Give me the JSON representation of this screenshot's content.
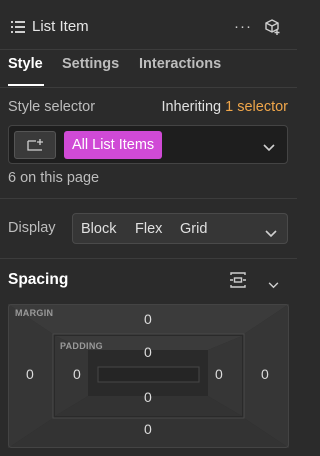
{
  "header": {
    "title": "List Item",
    "icons": [
      "list-icon",
      "more-icon",
      "cube-icon"
    ],
    "more_glyph": "···"
  },
  "tabs": [
    {
      "label": "Style",
      "active": true
    },
    {
      "label": "Settings",
      "active": false
    },
    {
      "label": "Interactions",
      "active": false
    }
  ],
  "style_selector": {
    "label": "Style selector",
    "inheriting_prefix": "Inheriting",
    "inheriting_count": "1 selector",
    "chip_label": "All List Items",
    "on_page": "6 on this page"
  },
  "display": {
    "label": "Display",
    "options": [
      "Block",
      "Flex",
      "Grid"
    ]
  },
  "spacing": {
    "title": "Spacing",
    "margin_label": "MARGIN",
    "padding_label": "PADDING",
    "margin": {
      "top": "0",
      "right": "0",
      "bottom": "0",
      "left": "0"
    },
    "padding": {
      "top": "0",
      "right": "0",
      "bottom": "0",
      "left": "0"
    }
  },
  "colors": {
    "background": "#2b2b2b",
    "chip": "#d04ad6",
    "accent_orange": "#f0a64a"
  }
}
